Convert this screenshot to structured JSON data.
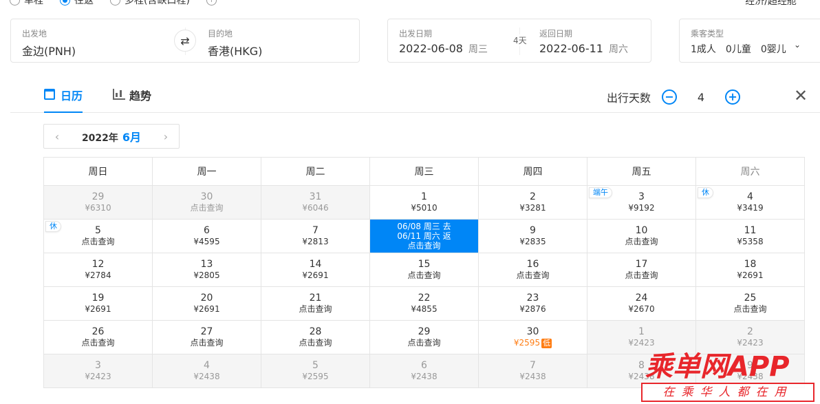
{
  "trip_types": [
    {
      "label": "单程",
      "selected": false
    },
    {
      "label": "往返",
      "selected": true
    },
    {
      "label": "多程(含缺口程)",
      "selected": false
    }
  ],
  "cabin": "经济/超经舱",
  "search": {
    "from_label": "出发地",
    "from_value": "金边(PNH)",
    "to_label": "目的地",
    "to_value": "香港(HKG)",
    "depart_label": "出发日期",
    "depart_date": "2022-06-08",
    "depart_weekday": "周三",
    "days_badge": "4天",
    "return_label": "返回日期",
    "return_date": "2022-06-11",
    "return_weekday": "周六",
    "pax_label": "乘客类型",
    "pax_value": "1成人　0儿童　0婴儿"
  },
  "tabs": [
    {
      "label": "日历",
      "active": true
    },
    {
      "label": "趋势",
      "active": false
    }
  ],
  "stay": {
    "label": "出行天数",
    "value": "4"
  },
  "month_nav": {
    "year": "2022年",
    "month": "6月"
  },
  "weekdays": [
    "周日",
    "周一",
    "周二",
    "周三",
    "周四",
    "周五",
    "周六"
  ],
  "accent": "#0086f6",
  "low_color": "#ff7d13",
  "calendar": [
    [
      {
        "day": "29",
        "price": "¥6310",
        "out": true
      },
      {
        "day": "30",
        "price": "点击查询",
        "out": true
      },
      {
        "day": "31",
        "price": "¥6046",
        "out": true
      },
      {
        "day": "1",
        "price": "¥5010"
      },
      {
        "day": "2",
        "price": "¥3281"
      },
      {
        "day": "3",
        "price": "¥9192",
        "tag": "端午"
      },
      {
        "day": "4",
        "price": "¥3419",
        "tag": "休"
      }
    ],
    [
      {
        "day": "5",
        "price": "点击查询",
        "tag": "休"
      },
      {
        "day": "6",
        "price": "¥4595"
      },
      {
        "day": "7",
        "price": "¥2813"
      },
      {
        "selected": true,
        "lines": [
          "06/08 周三 去",
          "06/11 周六 返",
          "点击查询"
        ]
      },
      {
        "day": "9",
        "price": "¥2835"
      },
      {
        "day": "10",
        "price": "点击查询"
      },
      {
        "day": "11",
        "price": "¥5358"
      }
    ],
    [
      {
        "day": "12",
        "price": "¥2784"
      },
      {
        "day": "13",
        "price": "¥2805"
      },
      {
        "day": "14",
        "price": "¥2691"
      },
      {
        "day": "15",
        "price": "点击查询"
      },
      {
        "day": "16",
        "price": "点击查询"
      },
      {
        "day": "17",
        "price": "点击查询"
      },
      {
        "day": "18",
        "price": "¥2691"
      }
    ],
    [
      {
        "day": "19",
        "price": "¥2691"
      },
      {
        "day": "20",
        "price": "¥2691"
      },
      {
        "day": "21",
        "price": "点击查询"
      },
      {
        "day": "22",
        "price": "¥4855"
      },
      {
        "day": "23",
        "price": "¥2876"
      },
      {
        "day": "24",
        "price": "¥2670"
      },
      {
        "day": "25",
        "price": "点击查询"
      }
    ],
    [
      {
        "day": "26",
        "price": "点击查询"
      },
      {
        "day": "27",
        "price": "点击查询"
      },
      {
        "day": "28",
        "price": "点击查询"
      },
      {
        "day": "29",
        "price": "点击查询"
      },
      {
        "day": "30",
        "price": "¥2595",
        "low": "低"
      },
      {
        "day": "1",
        "price": "¥2423",
        "out": true
      },
      {
        "day": "2",
        "price": "¥2423",
        "out": true
      }
    ],
    [
      {
        "day": "3",
        "price": "¥2423",
        "out": true
      },
      {
        "day": "4",
        "price": "¥2438",
        "out": true
      },
      {
        "day": "5",
        "price": "¥2595",
        "out": true
      },
      {
        "day": "6",
        "price": "¥2438",
        "out": true
      },
      {
        "day": "7",
        "price": "¥2438",
        "out": true
      },
      {
        "day": "8",
        "price": "¥2438",
        "out": true
      },
      {
        "day": "9",
        "price": "¥2438",
        "out": true
      }
    ]
  ],
  "watermark": {
    "main": "乘单网APP",
    "sub": "在乘华人都在用"
  }
}
